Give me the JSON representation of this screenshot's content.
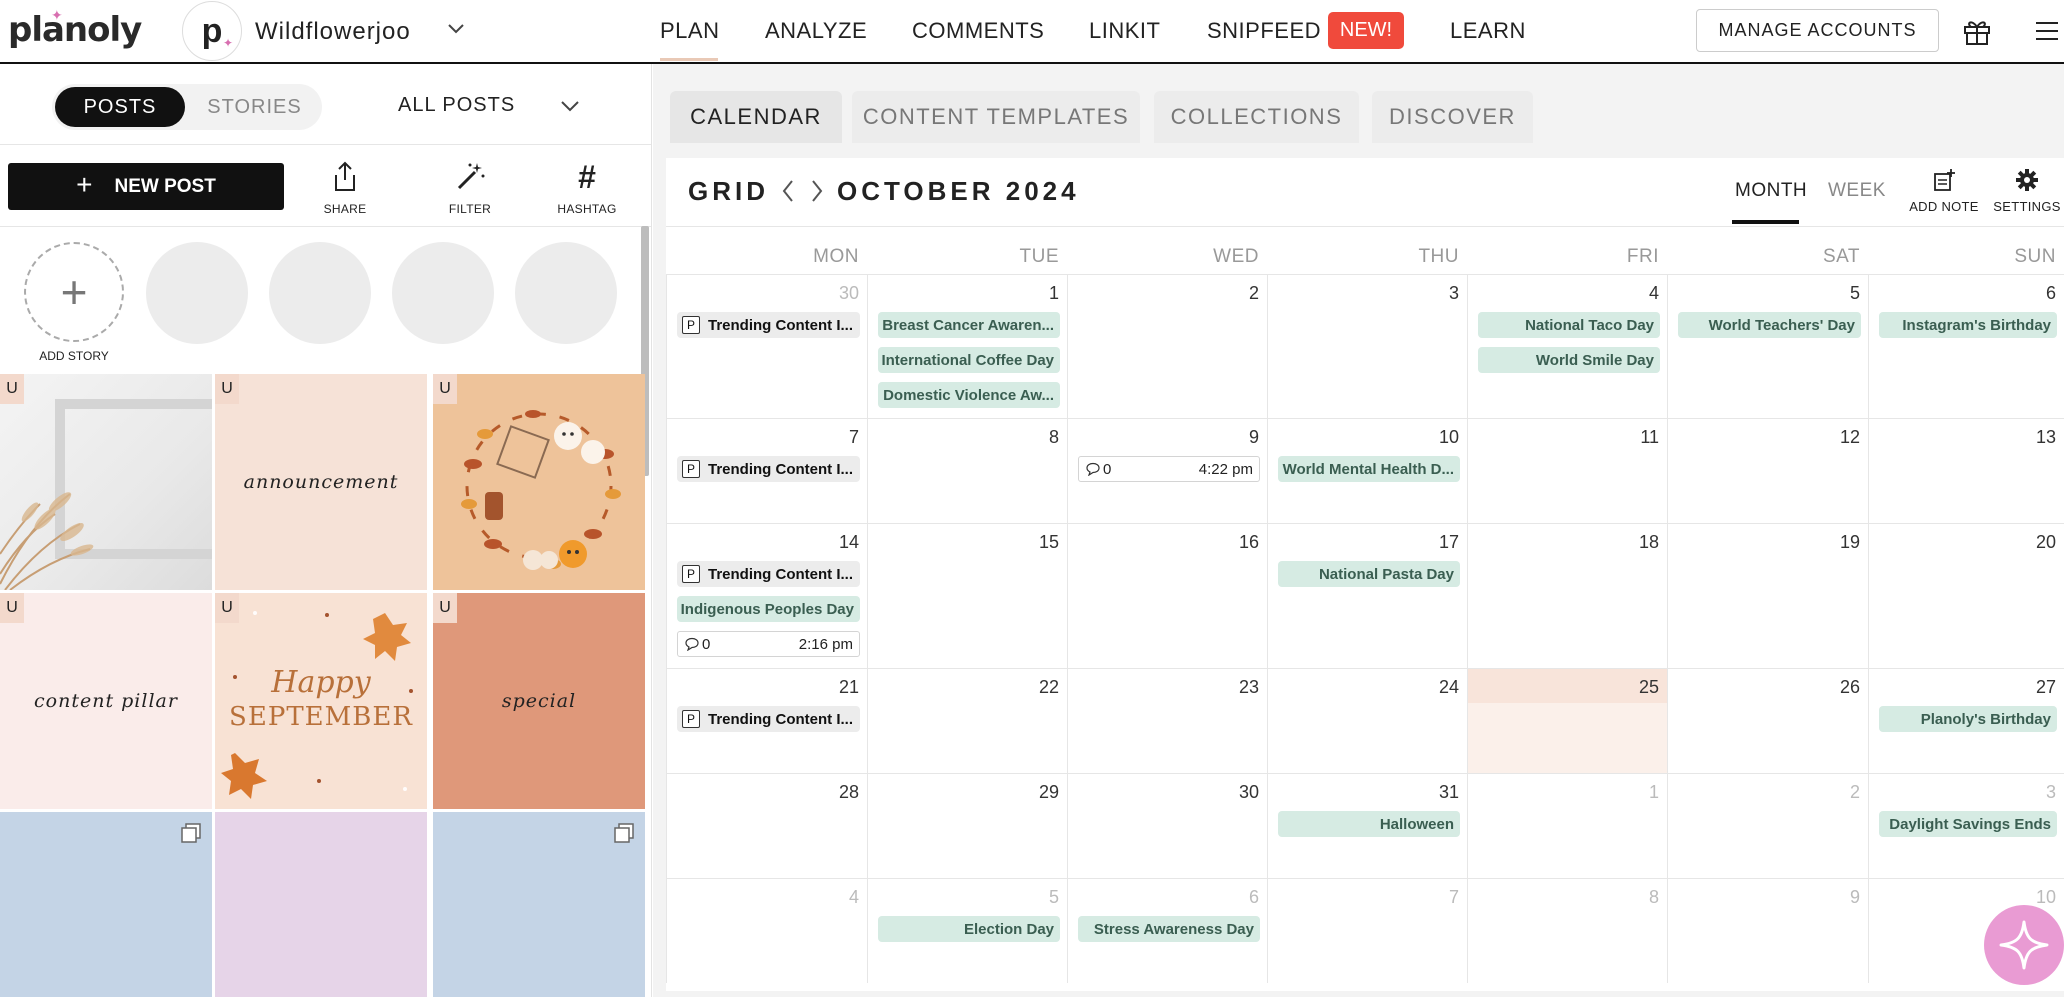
{
  "brand": {
    "logo": "planoly"
  },
  "account": {
    "avatar_letter": "p",
    "name": "Wildflowerjoo"
  },
  "nav": {
    "items": [
      "PLAN",
      "ANALYZE",
      "COMMENTS",
      "LINKIT",
      "SNIPFEED",
      "LEARN"
    ],
    "active": "PLAN",
    "new_badge": "NEW!",
    "manage_accounts": "MANAGE ACCOUNTS"
  },
  "left": {
    "toggle": {
      "posts": "POSTS",
      "stories": "STORIES"
    },
    "filter": "ALL POSTS",
    "new_post": "NEW POST",
    "tools": {
      "share": "SHARE",
      "filter": "FILTER",
      "hashtag": "HASHTAG"
    },
    "add_story": "ADD STORY",
    "tiles": [
      {
        "badge": "U",
        "caption": ""
      },
      {
        "badge": "U",
        "caption": "announcement"
      },
      {
        "badge": "U",
        "caption": ""
      },
      {
        "badge": "U",
        "caption": "content pillar"
      },
      {
        "badge": "U",
        "caption_line1": "Happy",
        "caption_line2": "SEPTEMBER"
      },
      {
        "badge": "U",
        "caption": "special"
      }
    ]
  },
  "tabs": [
    "CALENDAR",
    "CONTENT TEMPLATES",
    "COLLECTIONS",
    "DISCOVER"
  ],
  "calendar": {
    "grid_label": "GRID",
    "month_label": "OCTOBER 2024",
    "views": {
      "month": "MONTH",
      "week": "WEEK"
    },
    "add_note": "ADD NOTE",
    "settings": "SETTINGS",
    "weekdays": [
      "MON",
      "TUE",
      "WED",
      "THU",
      "FRI",
      "SAT",
      "SUN"
    ],
    "weeks": [
      [
        {
          "day": "30",
          "dim": true,
          "items": [
            {
              "type": "post",
              "label": "Trending Content I..."
            }
          ]
        },
        {
          "day": "1",
          "items": [
            {
              "type": "event",
              "label": "Breast Cancer Awaren..."
            },
            {
              "type": "event",
              "label": "International Coffee Day"
            },
            {
              "type": "event",
              "label": "Domestic Violence Aw..."
            }
          ]
        },
        {
          "day": "2",
          "items": []
        },
        {
          "day": "3",
          "items": []
        },
        {
          "day": "4",
          "items": [
            {
              "type": "event",
              "label": "National Taco Day"
            },
            {
              "type": "event",
              "label": "World Smile Day"
            }
          ]
        },
        {
          "day": "5",
          "items": [
            {
              "type": "event",
              "label": "World Teachers' Day"
            }
          ]
        },
        {
          "day": "6",
          "items": [
            {
              "type": "event",
              "label": "Instagram's Birthday"
            }
          ]
        }
      ],
      [
        {
          "day": "7",
          "items": [
            {
              "type": "post",
              "label": "Trending Content I..."
            }
          ]
        },
        {
          "day": "8",
          "items": []
        },
        {
          "day": "9",
          "items": [
            {
              "type": "scheduled",
              "comments": "0",
              "time": "4:22 pm"
            }
          ]
        },
        {
          "day": "10",
          "items": [
            {
              "type": "event",
              "label": "World Mental Health D..."
            }
          ]
        },
        {
          "day": "11",
          "items": []
        },
        {
          "day": "12",
          "items": []
        },
        {
          "day": "13",
          "items": []
        }
      ],
      [
        {
          "day": "14",
          "items": [
            {
              "type": "post",
              "label": "Trending Content I..."
            },
            {
              "type": "event",
              "label": "Indigenous Peoples Day"
            },
            {
              "type": "scheduled",
              "comments": "0",
              "time": "2:16 pm"
            }
          ]
        },
        {
          "day": "15",
          "items": []
        },
        {
          "day": "16",
          "items": []
        },
        {
          "day": "17",
          "items": [
            {
              "type": "event",
              "label": "National Pasta Day"
            }
          ]
        },
        {
          "day": "18",
          "items": []
        },
        {
          "day": "19",
          "items": []
        },
        {
          "day": "20",
          "items": []
        }
      ],
      [
        {
          "day": "21",
          "items": [
            {
              "type": "post",
              "label": "Trending Content I..."
            }
          ]
        },
        {
          "day": "22",
          "items": []
        },
        {
          "day": "23",
          "items": []
        },
        {
          "day": "24",
          "items": []
        },
        {
          "day": "25",
          "today": true,
          "items": []
        },
        {
          "day": "26",
          "items": []
        },
        {
          "day": "27",
          "items": [
            {
              "type": "event",
              "label": "Planoly's Birthday"
            }
          ]
        }
      ],
      [
        {
          "day": "28",
          "items": []
        },
        {
          "day": "29",
          "items": []
        },
        {
          "day": "30",
          "items": []
        },
        {
          "day": "31",
          "items": [
            {
              "type": "event",
              "label": "Halloween"
            }
          ]
        },
        {
          "day": "1",
          "dim": true,
          "items": []
        },
        {
          "day": "2",
          "dim": true,
          "items": []
        },
        {
          "day": "3",
          "dim": true,
          "items": [
            {
              "type": "event",
              "label": "Daylight Savings Ends"
            }
          ]
        }
      ],
      [
        {
          "day": "4",
          "dim": true,
          "items": []
        },
        {
          "day": "5",
          "dim": true,
          "items": [
            {
              "type": "event",
              "label": "Election Day"
            }
          ]
        },
        {
          "day": "6",
          "dim": true,
          "items": [
            {
              "type": "event",
              "label": "Stress Awareness Day"
            }
          ]
        },
        {
          "day": "7",
          "dim": true,
          "items": []
        },
        {
          "day": "8",
          "dim": true,
          "items": []
        },
        {
          "day": "9",
          "dim": true,
          "items": []
        },
        {
          "day": "10",
          "dim": true,
          "items": []
        }
      ]
    ]
  },
  "colors": {
    "accent_badge": "#f04a3c",
    "event_bg": "#d6ebe3",
    "event_text": "#3a5e51",
    "today_bg": "#fbf0ea",
    "fab": "#e99bd3"
  }
}
